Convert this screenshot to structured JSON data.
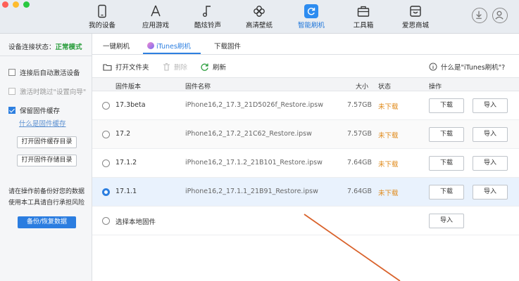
{
  "nav": {
    "items": [
      {
        "label": "我的设备",
        "icon": "phone-icon"
      },
      {
        "label": "应用游戏",
        "icon": "app-store-icon"
      },
      {
        "label": "酷炫铃声",
        "icon": "music-note-icon"
      },
      {
        "label": "高清壁纸",
        "icon": "flower-icon"
      },
      {
        "label": "智能刷机",
        "icon": "refresh-box-icon"
      },
      {
        "label": "工具箱",
        "icon": "toolbox-icon"
      },
      {
        "label": "爱思商城",
        "icon": "shop-icon"
      }
    ],
    "active_index": 4,
    "accent_color": "#2d8cf0"
  },
  "sidebar": {
    "status_label": "设备连接状态：",
    "status_value": "正常模式",
    "status_color": "#2a9d3c",
    "options": [
      {
        "label": "连接后自动激活设备",
        "checked": false,
        "disabled": false
      },
      {
        "label": "激活时跳过\"设置向导\"",
        "checked": false,
        "disabled": true
      },
      {
        "label": "保留固件缓存",
        "checked": true,
        "disabled": false
      }
    ],
    "cache_link": "什么是固件缓存",
    "open_cache_dir": "打开固件缓存目录",
    "open_storage_dir": "打开固件存储目录",
    "note": "请在操作前备份好您的数据使用本工具请自行承担风险",
    "backup_button": "备份/恢复数据"
  },
  "tabs": [
    {
      "label": "一键刷机"
    },
    {
      "label": "iTunes刷机",
      "active": true
    },
    {
      "label": "下载固件"
    }
  ],
  "toolbar": {
    "open_folder": "打开文件夹",
    "delete": "删除",
    "refresh": "刷新",
    "help": "什么是\"iTunes刷机\"?"
  },
  "table": {
    "headers": {
      "version": "固件版本",
      "name": "固件名称",
      "size": "大小",
      "status": "状态",
      "action": "操作"
    },
    "rows": [
      {
        "version": "17.3beta",
        "name": "iPhone16,2_17.3_21D5026f_Restore.ipsw",
        "size": "7.57GB",
        "status": "未下载",
        "download": "下载",
        "import": "导入",
        "selected": false
      },
      {
        "version": "17.2",
        "name": "iPhone16,2_17.2_21C62_Restore.ipsw",
        "size": "7.57GB",
        "status": "未下载",
        "download": "下载",
        "import": "导入",
        "selected": false
      },
      {
        "version": "17.1.2",
        "name": "iPhone16,2_17.1.2_21B101_Restore.ipsw",
        "size": "7.64GB",
        "status": "未下载",
        "download": "下载",
        "import": "导入",
        "selected": false
      },
      {
        "version": "17.1.1",
        "name": "iPhone16,2_17.1.1_21B91_Restore.ipsw",
        "size": "7.64GB",
        "status": "未下载",
        "download": "下载",
        "import": "导入",
        "selected": true
      }
    ],
    "local": {
      "label": "选择本地固件",
      "import": "导入"
    }
  },
  "annotation_color": "#d9622b"
}
